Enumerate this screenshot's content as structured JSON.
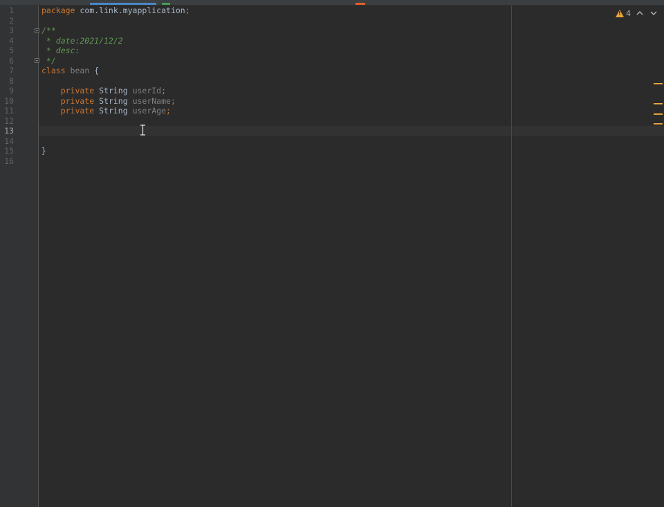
{
  "colors": {
    "background": "#2b2b2b",
    "gutter": "#313335",
    "keyword": "#cc7832",
    "comment": "#629755",
    "unused": "#808080",
    "text": "#a9b7c6",
    "warning": "#e8a33d",
    "active_tab_underline": "#4a88c7",
    "tab_icon_green": "#499c54",
    "tab_icon_orange": "#e0622b"
  },
  "inspection": {
    "warning_icon": "warning-triangle-icon",
    "count": "4",
    "prev_icon": "chevron-up-icon",
    "next_icon": "chevron-down-icon",
    "prev_glyph": "⌃",
    "next_glyph": "⌄"
  },
  "editor": {
    "current_line": 13,
    "line_numbers": [
      "1",
      "2",
      "3",
      "4",
      "5",
      "6",
      "7",
      "8",
      "9",
      "10",
      "11",
      "12",
      "13",
      "14",
      "15",
      "16"
    ],
    "lines": [
      {
        "kw": "package",
        "rest": " com.link.myapplication",
        "end": ";"
      },
      {},
      {
        "comment": "/**"
      },
      {
        "comment": " * date:2021/12/2"
      },
      {
        "comment": " * desc:"
      },
      {
        "comment": " */"
      },
      {
        "kw": "class",
        "name": " bean",
        "rest": " {"
      },
      {},
      {
        "kw": "    private",
        "type": " String",
        "field": " userId",
        "end": ";"
      },
      {
        "kw": "    private",
        "type": " String",
        "field": " userName",
        "end": ";"
      },
      {
        "kw": "    private",
        "type": " String",
        "field": " userAge",
        "end": ";"
      },
      {},
      {},
      {},
      {
        "rest": "}"
      },
      {}
    ]
  }
}
